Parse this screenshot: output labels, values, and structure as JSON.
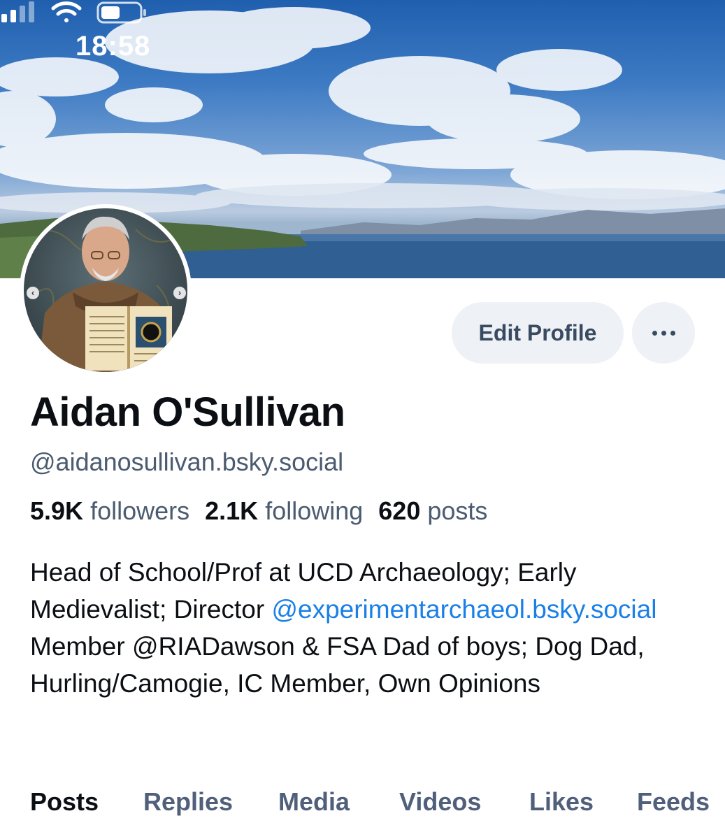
{
  "status_bar": {
    "time": "18:58",
    "icons": [
      "signal-icon",
      "wifi-icon",
      "battery-icon"
    ]
  },
  "profile": {
    "display_name": "Aidan O'Sullivan",
    "handle": "@aidanosullivan.bsky.social",
    "stats": {
      "followers_count": "5.9K",
      "followers_label": "followers",
      "following_count": "2.1K",
      "following_label": "following",
      "posts_count": "620",
      "posts_label": "posts"
    },
    "bio": {
      "part1": "Head of School/Prof at UCD Archaeology; Early Medievalist; Director ",
      "mention": "@experimentarchaeol.bsky.social",
      "part2": " Member @RIADawson & FSA Dad of boys; Dog Dad, Hurling/Camogie, IC Member, Own Opinions"
    }
  },
  "actions": {
    "edit_profile": "Edit Profile",
    "more_icon": "ellipsis-icon"
  },
  "tabs": [
    {
      "label": "Posts",
      "active": true
    },
    {
      "label": "Replies",
      "active": false
    },
    {
      "label": "Media",
      "active": false
    },
    {
      "label": "Videos",
      "active": false
    },
    {
      "label": "Likes",
      "active": false
    },
    {
      "label": "Feeds",
      "active": false
    }
  ],
  "colors": {
    "mention": "#1a7fe6",
    "secondary_text": "#4b5b70",
    "button_bg": "#eef1f5"
  }
}
